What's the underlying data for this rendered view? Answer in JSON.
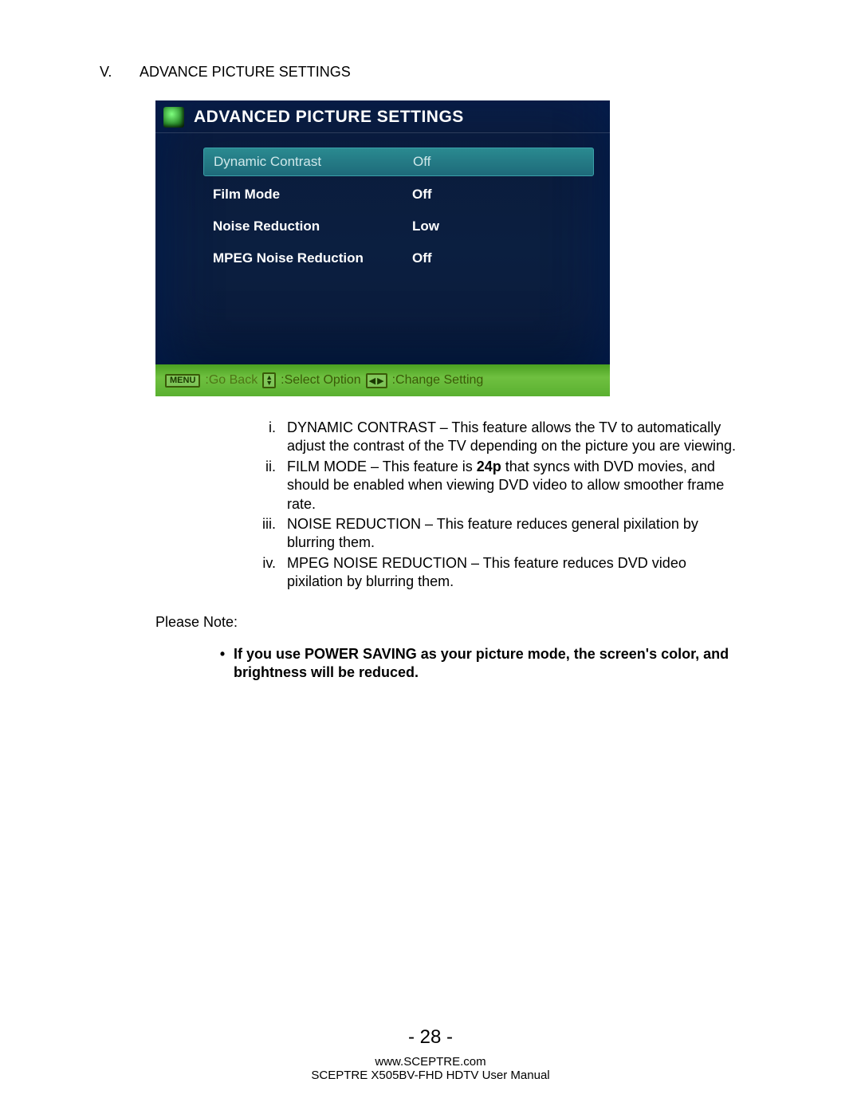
{
  "section": {
    "numeral": "V.",
    "title": "ADVANCE PICTURE SETTINGS"
  },
  "osd": {
    "title": "ADVANCED PICTURE SETTINGS",
    "rows": [
      {
        "label": "Dynamic Contrast",
        "value": "Off",
        "selected": true
      },
      {
        "label": "Film Mode",
        "value": "Off",
        "selected": false
      },
      {
        "label": "Noise Reduction",
        "value": "Low",
        "selected": false
      },
      {
        "label": "MPEG Noise Reduction",
        "value": "Off",
        "selected": false
      }
    ],
    "footer": {
      "menu_key": "MENU",
      "go_back": ":Go Back",
      "select_option": ":Select Option",
      "change_setting": ":Change Setting"
    }
  },
  "definitions": [
    {
      "num": "i.",
      "term": "DYNAMIC CONTRAST",
      "body": " – This feature allows the TV to automatically adjust the contrast of the TV depending on the picture you are viewing."
    },
    {
      "num": "ii.",
      "term": "FILM MODE",
      "body_pre": " – This feature is ",
      "body_bold": "24p",
      "body_post": " that syncs with DVD movies, and should be enabled when viewing DVD video to allow smoother frame rate."
    },
    {
      "num": "iii.",
      "term": "NOISE REDUCTION",
      "body": " – This feature reduces general pixilation by blurring them."
    },
    {
      "num": "iv.",
      "term": "MPEG NOISE REDUCTION",
      "body": " – This feature reduces DVD video pixilation by blurring them."
    }
  ],
  "please_note": "Please Note:",
  "bullet": "If you use POWER SAVING as your picture mode, the screen's color, and brightness will be reduced.",
  "page_number": "- 28 -",
  "footer_url": "www.SCEPTRE.com",
  "footer_doc": "SCEPTRE X505BV-FHD HDTV User Manual"
}
